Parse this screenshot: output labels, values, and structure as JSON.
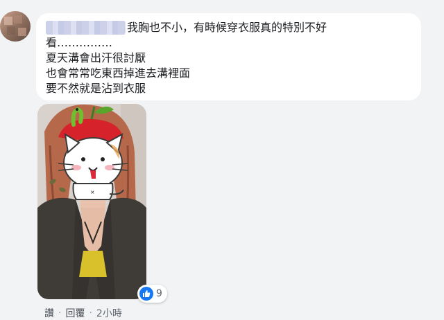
{
  "comment": {
    "lines": [
      "我胸也不小，有時候穿衣服真的特別不好",
      "看……………",
      "夏天溝會出汗很討厭",
      "也會常常吃東西掉進去溝裡面",
      "要不然就是沾到衣服"
    ]
  },
  "reaction": {
    "icon": "thumbs-up-icon",
    "count": "9",
    "color": "#1877f2"
  },
  "actions": {
    "like_label": "讚",
    "reply_label": "回覆",
    "separator": "·",
    "time": "2小時"
  },
  "colors": {
    "background": "#f2f3f5",
    "bubble": "#ffffff",
    "text": "#1c1e21",
    "meta": "#606770"
  }
}
